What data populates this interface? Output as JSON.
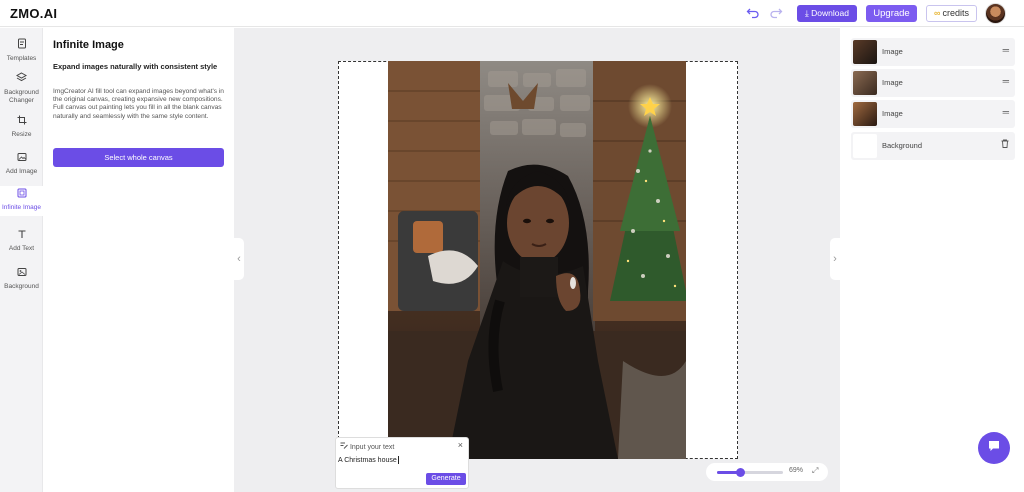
{
  "header": {
    "logo": "ZMO.AI",
    "download_label": "⤓ Download",
    "upgrade_label": "Upgrade",
    "credits_label": "credits",
    "credits_icon": "∞"
  },
  "nav": {
    "items": [
      {
        "label": "Templates",
        "icon": "template-icon"
      },
      {
        "label": "Background Changer",
        "icon": "layers-icon"
      },
      {
        "label": "Resize",
        "icon": "crop-icon"
      },
      {
        "label": "Add Image",
        "icon": "image-icon"
      },
      {
        "label": "Infinite Image",
        "icon": "infinite-image-icon",
        "active": true
      },
      {
        "label": "Add Text",
        "icon": "text-icon"
      },
      {
        "label": "Background",
        "icon": "background-icon"
      }
    ]
  },
  "panel": {
    "title": "Infinite Image",
    "subtitle": "Expand images naturally with consistent style",
    "description": "ImgCreator AI fill tool can expand images beyond what's in the original canvas, creating expansive new compositions. Full canvas out painting lets you fill in all the blank canvas naturally and seamlessly with the same style content.",
    "select_button": "Select whole canvas"
  },
  "prompt": {
    "placeholder": "Input your text",
    "value": "A Christmas house",
    "generate_label": "Generate"
  },
  "zoom": {
    "value_label": "69%",
    "level": 0.69
  },
  "layers": {
    "items": [
      {
        "name": "Image",
        "action_icon": "drag-handle-icon"
      },
      {
        "name": "Image",
        "action_icon": "drag-handle-icon"
      },
      {
        "name": "Image",
        "action_icon": "drag-handle-icon"
      },
      {
        "name": "Background",
        "action_icon": "trash-icon"
      }
    ]
  },
  "colors": {
    "accent": "#6b4de6"
  }
}
